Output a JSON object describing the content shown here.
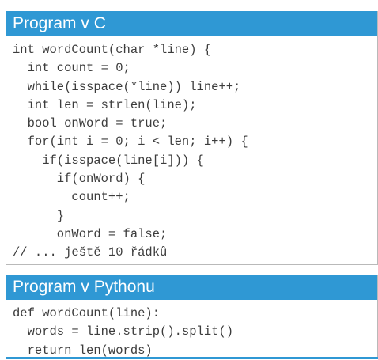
{
  "panels": [
    {
      "title": "Program v C",
      "lines": [
        "int wordCount(char *line) {",
        "  int count = 0;",
        "  while(isspace(*line)) line++;",
        "  int len = strlen(line);",
        "  bool onWord = true;",
        "  for(int i = 0; i < len; i++) {",
        "    if(isspace(line[i])) {",
        "      if(onWord) {",
        "        count++;",
        "      }",
        "      onWord = false;",
        "// ... ještě 10 řádků"
      ]
    },
    {
      "title": "Program v Pythonu",
      "lines": [
        "def wordCount(line):",
        "  words = line.strip().split()",
        "  return len(words)"
      ]
    }
  ],
  "colors": {
    "header": "#2f98d4",
    "code_text": "#3c3c3c",
    "border": "#b9b9b9"
  }
}
